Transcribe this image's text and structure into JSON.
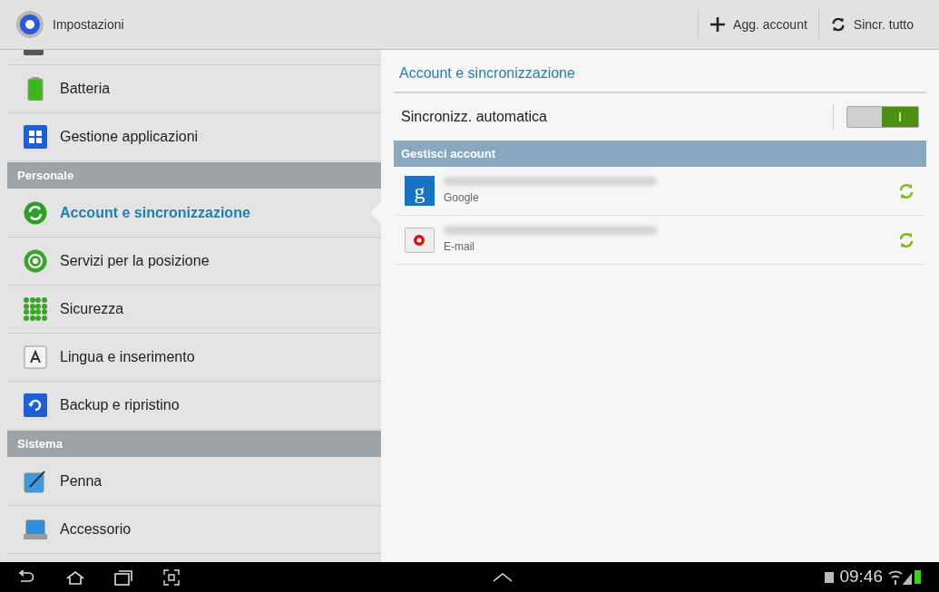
{
  "action_bar": {
    "title": "Impostazioni",
    "actions": [
      {
        "kind": "add",
        "label": "Agg. account"
      },
      {
        "kind": "sync",
        "label": "Sincr. tutto"
      }
    ]
  },
  "sidebar": {
    "items": [
      {
        "kind": "item",
        "label": "Batteria",
        "selected": false
      },
      {
        "kind": "item",
        "label": "Gestione applicazioni",
        "selected": false
      },
      {
        "kind": "header",
        "label": "Personale"
      },
      {
        "kind": "item",
        "label": "Account e sincronizzazione",
        "selected": true
      },
      {
        "kind": "item",
        "label": "Servizi per la posizione",
        "selected": false
      },
      {
        "kind": "item",
        "label": "Sicurezza",
        "selected": false
      },
      {
        "kind": "item",
        "label": "Lingua e inserimento",
        "selected": false
      },
      {
        "kind": "item",
        "label": "Backup e ripristino",
        "selected": false
      },
      {
        "kind": "header",
        "label": "Sistema"
      },
      {
        "kind": "item",
        "label": "Penna",
        "selected": false
      },
      {
        "kind": "item",
        "label": "Accessorio",
        "selected": false
      }
    ]
  },
  "detail": {
    "title": "Account e sincronizzazione",
    "auto_sync": {
      "label": "Sincronizz. automatica",
      "on": true
    },
    "section": "Gestisci account",
    "accounts": [
      {
        "kind": "google",
        "logo": "g",
        "type": "Google"
      },
      {
        "kind": "email",
        "type": "E-mail"
      }
    ]
  },
  "status_bar": {
    "time": "09:46"
  }
}
